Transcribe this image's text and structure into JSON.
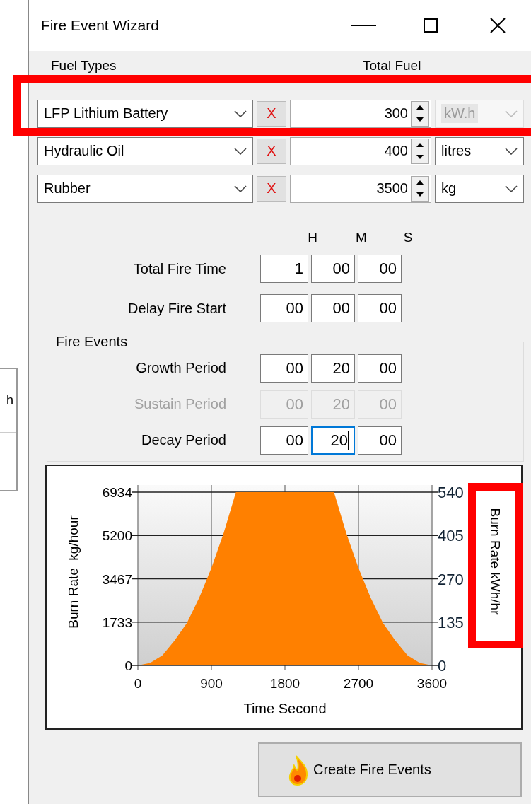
{
  "background_window": {
    "cell_text": "h"
  },
  "window": {
    "title": "Fire Event Wizard"
  },
  "fuel_headers": {
    "fuel_types": "Fuel Types",
    "total_fuel": "Total Fuel"
  },
  "fuels": [
    {
      "type": "LFP Lithium Battery",
      "remove": "X",
      "amount": "300",
      "unit": "kW.h",
      "unit_disabled": true
    },
    {
      "type": "Hydraulic Oil",
      "remove": "X",
      "amount": "400",
      "unit": "litres",
      "unit_disabled": false
    },
    {
      "type": "Rubber",
      "remove": "X",
      "amount": "3500",
      "unit": "kg",
      "unit_disabled": false
    }
  ],
  "time_headers": [
    "H",
    "M",
    "S"
  ],
  "time_rows": [
    {
      "label": "Total Fire Time",
      "disabled": false,
      "fields": [
        {
          "value": "1",
          "focused": false
        },
        {
          "value": "00",
          "focused": false
        },
        {
          "value": "00",
          "focused": false
        }
      ]
    },
    {
      "label": "Delay Fire Start",
      "disabled": false,
      "fields": [
        {
          "value": "00",
          "focused": false
        },
        {
          "value": "00",
          "focused": false
        },
        {
          "value": "00",
          "focused": false
        }
      ]
    }
  ],
  "fire_events": {
    "title": "Fire Events",
    "rows": [
      {
        "label": "Growth Period",
        "disabled": false,
        "fields": [
          {
            "value": "00",
            "focused": false
          },
          {
            "value": "20",
            "focused": false
          },
          {
            "value": "00",
            "focused": false
          }
        ]
      },
      {
        "label": "Sustain Period",
        "disabled": true,
        "fields": [
          {
            "value": "00",
            "focused": false
          },
          {
            "value": "20",
            "focused": false
          },
          {
            "value": "00",
            "focused": false
          }
        ]
      },
      {
        "label": "Decay Period",
        "disabled": false,
        "fields": [
          {
            "value": "00",
            "focused": false
          },
          {
            "value": "20",
            "focused": true
          },
          {
            "value": "00",
            "focused": false
          }
        ]
      }
    ]
  },
  "chart": {
    "chart_data": {
      "type": "area",
      "grid": true,
      "xlabel": "Time Second",
      "ylabel": "Burn Rate  kg/hour",
      "xlim": [
        0,
        3600
      ],
      "ylim": [
        0,
        6934
      ],
      "xticks": [
        0,
        900,
        1800,
        2700,
        3600
      ],
      "yticks": [
        0,
        1733,
        3467,
        5200,
        6934
      ],
      "x": [
        0,
        150,
        300,
        450,
        600,
        750,
        900,
        1050,
        1200,
        1800,
        2400,
        2550,
        2700,
        2850,
        3000,
        3150,
        3300,
        3450,
        3600
      ],
      "series": [
        {
          "color": "#ff8000",
          "values": [
            0,
            100,
            400,
            1000,
            1700,
            2700,
            3900,
            5300,
            6934,
            6934,
            6934,
            5300,
            3900,
            2700,
            1700,
            1000,
            400,
            100,
            0
          ]
        }
      ]
    },
    "right_axis": {
      "label": "Burn Rate kWh/hr",
      "ticks": [
        "540",
        "405",
        "270",
        "135",
        "0"
      ]
    }
  },
  "create_button": {
    "label": "Create Fire Events"
  }
}
